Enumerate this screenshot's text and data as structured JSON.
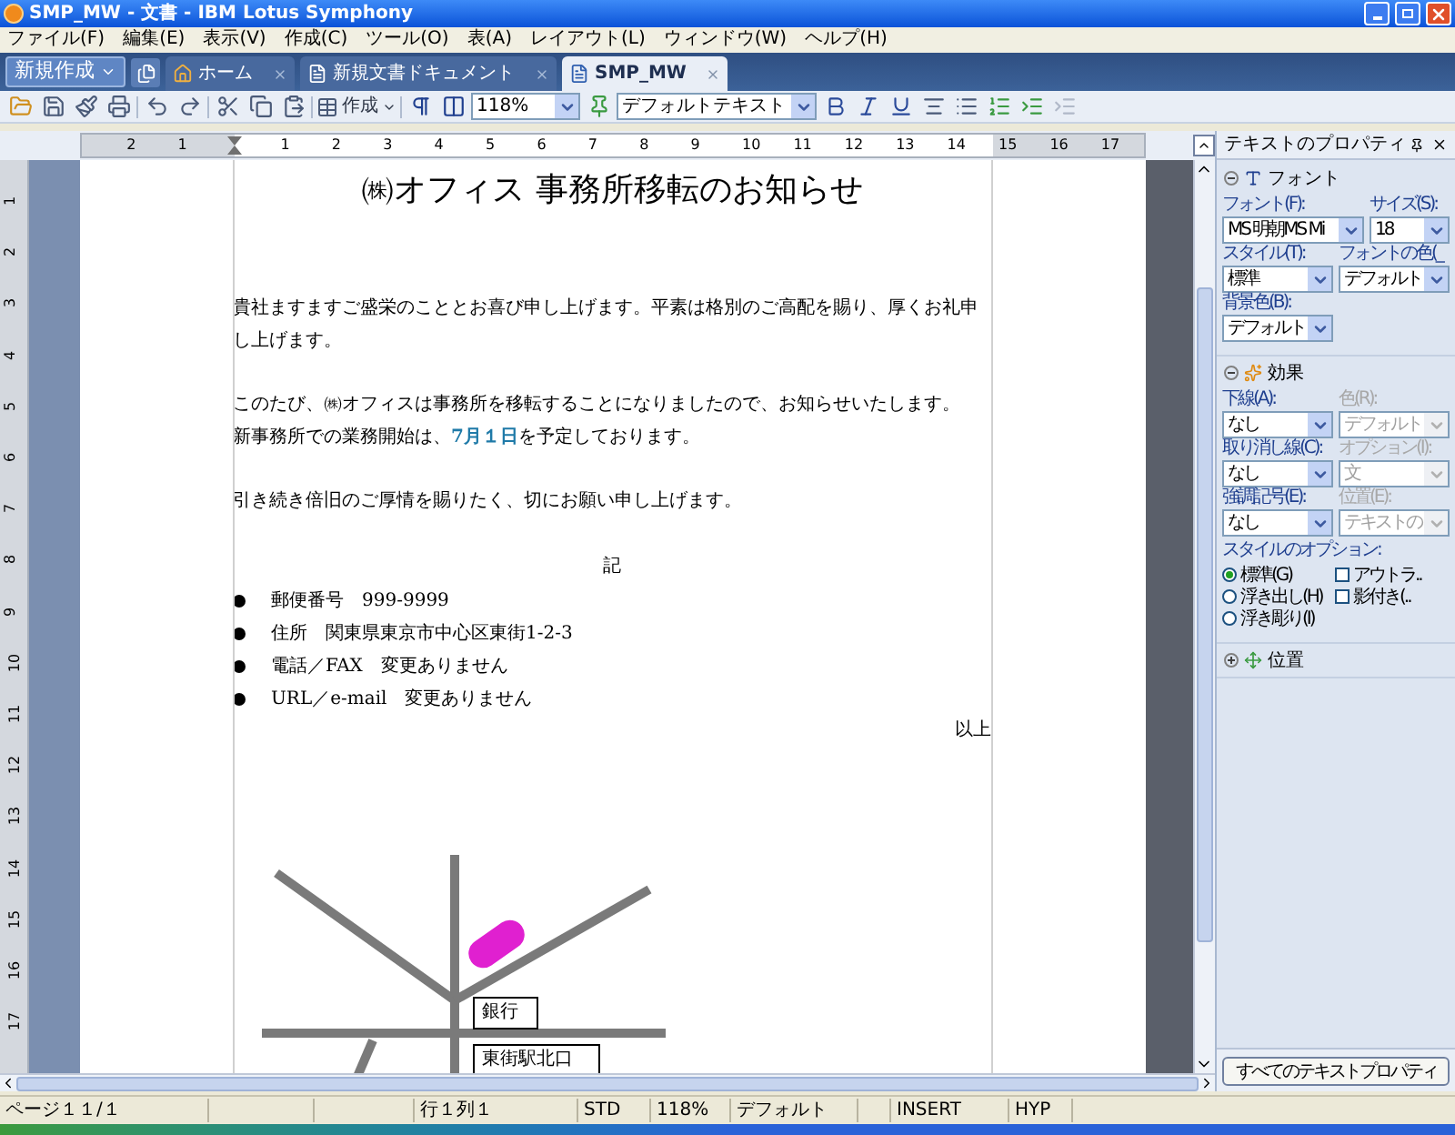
{
  "window": {
    "title": "SMP_MW - 文書 - IBM Lotus Symphony"
  },
  "menu": [
    "ファイル(F)",
    "編集(E)",
    "表示(V)",
    "作成(C)",
    "ツール(O)",
    "表(A)",
    "レイアウト(L)",
    "ウィンドウ(W)",
    "ヘルプ(H)"
  ],
  "new_button": {
    "label": "新規作成"
  },
  "tabs": [
    {
      "kind": "home",
      "label": "ホーム",
      "selected": false
    },
    {
      "kind": "doc",
      "label": "新規文書ドキュメント",
      "selected": false
    },
    {
      "kind": "doc",
      "label": "SMP_MW",
      "selected": true
    }
  ],
  "toolbar": {
    "create": "作成",
    "zoom": "118%",
    "paragraph_style": "デフォルトテキスト"
  },
  "ruler": {
    "left_labels": [
      "2",
      "1"
    ],
    "labels": [
      "1",
      "2",
      "3",
      "4",
      "5",
      "6",
      "7",
      "8",
      "9",
      "10",
      "11",
      "12",
      "13",
      "14",
      "15",
      "16",
      "17"
    ],
    "vertical_labels": [
      "1",
      "2",
      "3",
      "4",
      "5",
      "6",
      "7",
      "8",
      "9",
      "10",
      "11",
      "12",
      "13",
      "14",
      "15",
      "16",
      "17"
    ]
  },
  "document": {
    "title": "㈱オフィス 事務所移転のお知らせ",
    "paragraphs": [
      [
        "貴社ますますご盛栄のこととお喜び申し上げます。平素は格別のご高配を賜り、厚くお礼申し上げます。"
      ],
      [
        "このたび、㈱オフィスは事務所を移転することになりましたので、お知らせいたします。",
        "新事務所での業務開始は、**7月１日**を予定しております。"
      ],
      [
        "引き続き倍旧のご厚情を賜りたく、切にお願い申し上げます。"
      ]
    ],
    "note_heading": "記",
    "bullets": [
      "郵便番号　999-9999",
      "住所　関東県東京市中心区東街1-2-3",
      "電話／FAX　変更ありません",
      "URL／e-mail　変更ありません"
    ],
    "closing": "以上"
  },
  "map": {
    "labels": [
      "銀行",
      "東街駅北口"
    ]
  },
  "panel": {
    "title": "テキストのプロパティ",
    "font_section": {
      "title": "フォント",
      "expanded": true,
      "fields": [
        {
          "label": "フォント(F):",
          "value": "MS 明朝MS Mi"
        },
        {
          "label": "サイズ(S):",
          "value": "18"
        },
        {
          "label": "スタイル(T):",
          "value": "標準"
        },
        {
          "label": "フォントの色(_",
          "value": "デフォルト"
        },
        {
          "label": "背景色(B):",
          "value": "デフォルト"
        }
      ]
    },
    "effects_section": {
      "title": "効果",
      "expanded": true,
      "fields": [
        {
          "label": "下線(A):",
          "value": "なし",
          "disabled": false
        },
        {
          "label": "色(R):",
          "value": "デフォルト",
          "disabled": true
        },
        {
          "label": "取り消し線(C):",
          "value": "なし",
          "disabled": false
        },
        {
          "label": "オプション(I):",
          "value": "文",
          "disabled": true
        },
        {
          "label": "強調記号(E):",
          "value": "なし",
          "disabled": false
        },
        {
          "label": "位置(E):",
          "value": "テキストの",
          "disabled": true
        }
      ],
      "style_options_label": "スタイルのオプション:",
      "radios": [
        {
          "label": "標準(G)",
          "selected": true
        },
        {
          "label": "浮き出し(H)",
          "selected": false
        },
        {
          "label": "浮き彫り(I)",
          "selected": false
        }
      ],
      "checkboxes": [
        {
          "label": "アウトラ..",
          "checked": false
        },
        {
          "label": "影付き(..",
          "checked": false
        }
      ]
    },
    "position_section": {
      "title": "位置",
      "expanded": false
    },
    "all_props_button": "すべてのテキストプロパティ"
  },
  "status_bar": [
    "ページ１１/１",
    "行１列１",
    "STD",
    "118%",
    "デフォルト",
    "INSERT",
    "HYP"
  ]
}
